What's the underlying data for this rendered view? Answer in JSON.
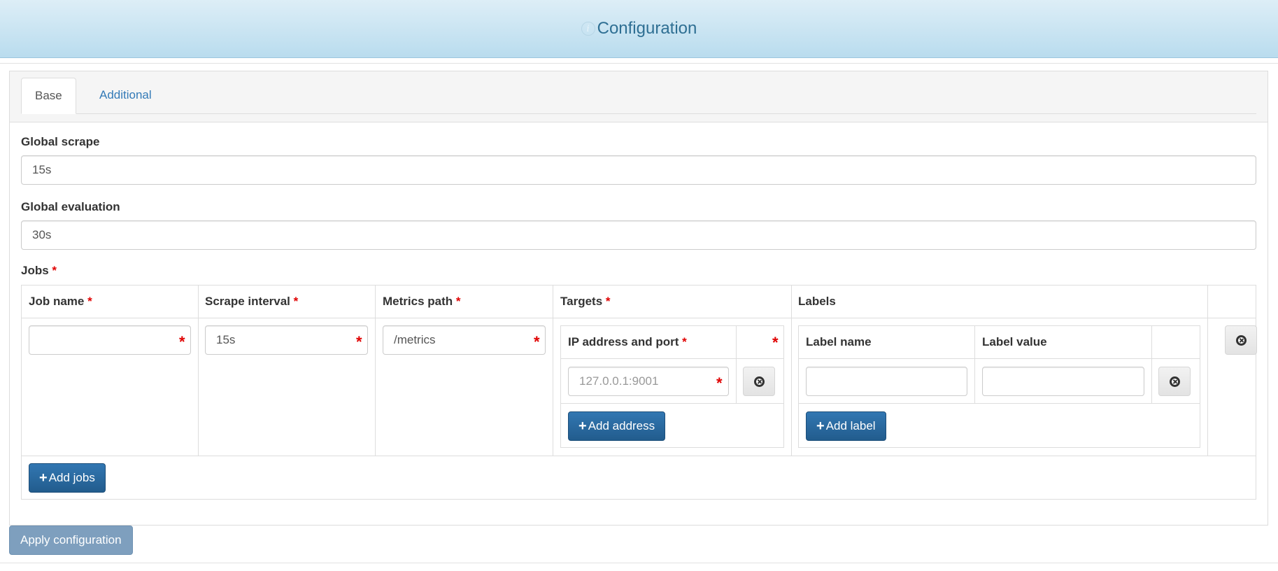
{
  "header": {
    "title": "Configuration",
    "info_glyph": "i"
  },
  "tabs": [
    {
      "label": "Base",
      "active": true
    },
    {
      "label": "Additional",
      "active": false
    }
  ],
  "form": {
    "global_scrape": {
      "label": "Global scrape",
      "value": "15s"
    },
    "global_evaluation": {
      "label": "Global evaluation",
      "value": "30s"
    },
    "jobs_label": "Jobs",
    "required_mark": "*"
  },
  "jobs_table": {
    "headers": {
      "job_name": "Job name",
      "scrape_interval": "Scrape interval",
      "metrics_path": "Metrics path",
      "targets": "Targets",
      "labels": "Labels"
    },
    "row": {
      "job_name": "",
      "scrape_interval": "15s",
      "metrics_path": "/metrics"
    },
    "targets": {
      "header": "IP address and port",
      "address_placeholder": "127.0.0.1:9001",
      "add_button": "Add address"
    },
    "labels": {
      "name_header": "Label name",
      "value_header": "Label value",
      "add_button": "Add label"
    },
    "add_jobs_button": "Add jobs"
  },
  "apply_button": "Apply configuration",
  "icons": {
    "plus": "+",
    "remove": "remove-circle-icon",
    "info": "info-circle-icon"
  },
  "colors": {
    "primary": "#286090",
    "required": "#e00000",
    "link": "#337ab7",
    "header_gradient_top": "#ddeef7",
    "header_gradient_bottom": "#b9dcee",
    "disabled_button": "#7e9fbe"
  }
}
